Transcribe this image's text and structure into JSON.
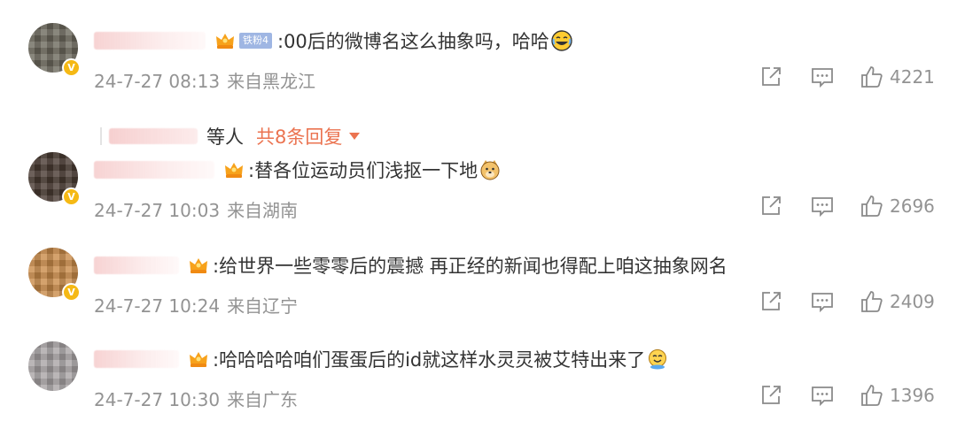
{
  "comments": [
    {
      "text": ":00后的微博名这么抽象吗，哈哈",
      "emoji": "laughing-tears-emoji",
      "fan_badge": "铁粉4",
      "date": "24-7-27 08:13",
      "location": "来自黑龙江",
      "likes": "4221",
      "replies": {
        "tail": "等人",
        "total": "共8条回复"
      }
    },
    {
      "text": ":替各位运动员们浅抠一下地",
      "emoji": "doge-emoji",
      "date": "24-7-27 10:03",
      "location": "来自湖南",
      "likes": "2696"
    },
    {
      "text": ":给世界一些零零后的震撼 再正经的新闻也得配上咱这抽象网名",
      "date": "24-7-27 10:24",
      "location": "来自辽宁",
      "likes": "2409"
    },
    {
      "text": ":哈哈哈哈咱们蛋蛋后的id就这样水灵灵被艾特出来了",
      "emoji": "crying-laughing-emoji",
      "date": "24-7-27 10:30",
      "location": "来自广东",
      "likes": "1396"
    }
  ],
  "colors": {
    "accent": "#eb7350",
    "meta": "#939393",
    "fan_badge": "#9fb6e3",
    "verified": "#f5b915"
  },
  "icons": [
    "share-icon",
    "comment-icon",
    "like-icon",
    "crown-icon",
    "verified-icon"
  ]
}
